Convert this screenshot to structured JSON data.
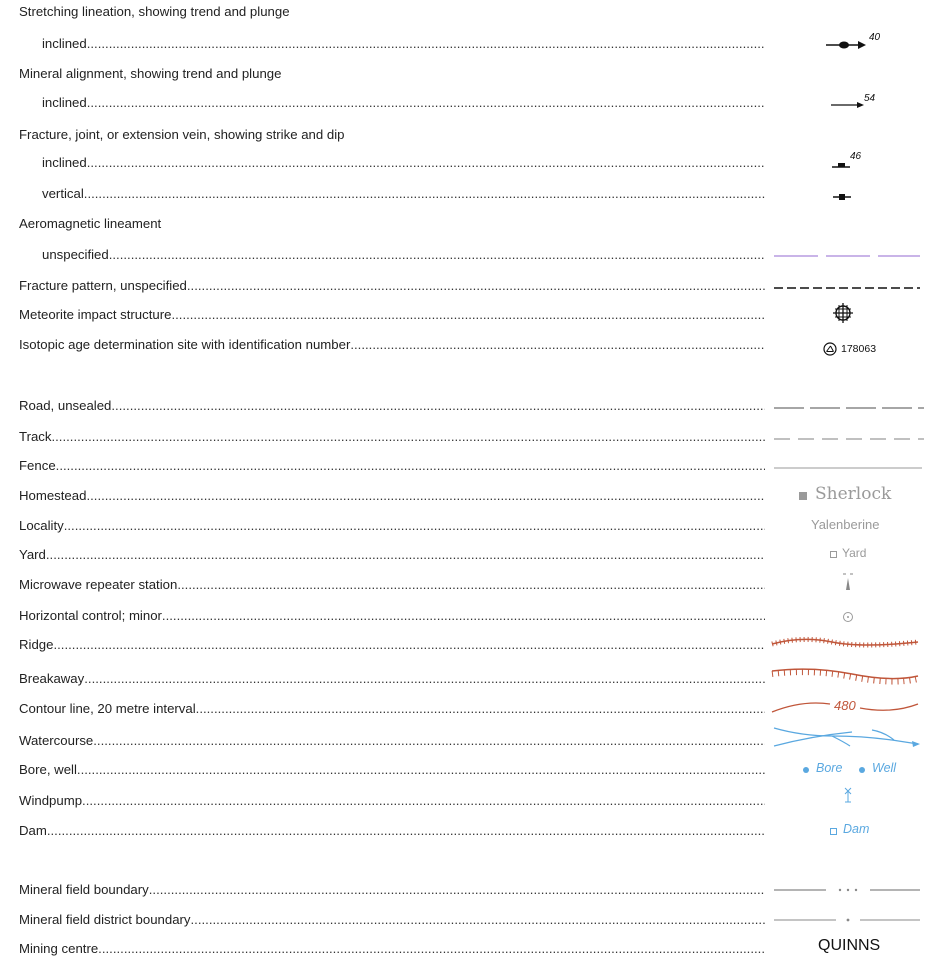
{
  "legend": {
    "structures": {
      "stretching_lineation": "Stretching lineation, showing trend and plunge",
      "stretching_inclined": "inclined",
      "stretching_value": "40",
      "mineral_alignment": "Mineral alignment, showing trend and plunge",
      "mineral_inclined": "inclined",
      "mineral_value": "54",
      "fracture": "Fracture, joint, or extension vein, showing strike and dip",
      "fracture_inclined": "inclined",
      "fracture_value": "46",
      "fracture_vertical": "vertical",
      "aeromagnetic": "Aeromagnetic lineament",
      "aeromagnetic_unspecified": "unspecified",
      "fracture_pattern": "Fracture pattern, unspecified",
      "meteorite": "Meteorite impact structure",
      "isotopic": "Isotopic age determination site with identification number",
      "isotopic_number": "178063"
    },
    "topography": {
      "road": "Road, unsealed",
      "track": "Track",
      "fence": "Fence",
      "homestead": "Homestead",
      "homestead_sample": "Sherlock",
      "locality": "Locality",
      "locality_sample": "Yalenberine",
      "yard": "Yard",
      "yard_sample": "Yard",
      "microwave": "Microwave repeater station",
      "horizontal_control": "Horizontal control; minor",
      "ridge": "Ridge",
      "breakaway": "Breakaway",
      "contour": "Contour line, 20 metre interval",
      "contour_value": "480",
      "watercourse": "Watercourse",
      "bore_well": "Bore, well",
      "bore_sample": "Bore",
      "well_sample": "Well",
      "windpump": "Windpump",
      "dam": "Dam",
      "dam_sample": "Dam"
    },
    "mining": {
      "mineral_field": "Mineral field boundary",
      "mineral_field_district": "Mineral field district boundary",
      "mining_centre": "Mining centre",
      "mining_centre_sample": "QUINNS"
    },
    "colors": {
      "black": "#111111",
      "grey": "#9a9a9a",
      "purple": "#b79be0",
      "brown": "#c0563a",
      "blue": "#5aa8e0",
      "text": "#222222"
    }
  }
}
